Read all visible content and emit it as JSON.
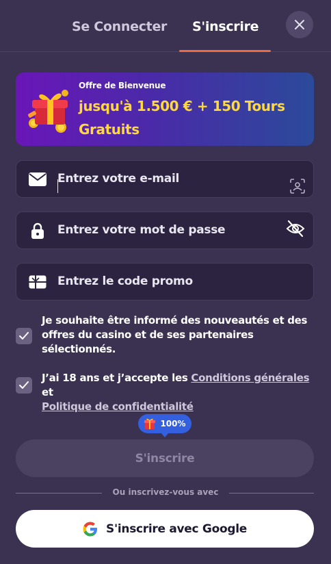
{
  "tabs": {
    "login": "Se Connecter",
    "register": "S'inscrire"
  },
  "banner": {
    "subtitle": "Offre de Bienvenue",
    "title": "jusqu'à 1.500 € + 150 Tours Gratuits"
  },
  "fields": {
    "email": {
      "placeholder": "Entrez votre e-mail",
      "icon": "mail-icon",
      "right_icon": "face-scan-icon"
    },
    "password": {
      "placeholder": "Entrez votre mot de passe",
      "icon": "lock-icon",
      "right_icon": "eye-off-icon"
    },
    "promo": {
      "placeholder": "Entrez le code promo",
      "icon": "gift-card-icon"
    }
  },
  "consents": {
    "news": {
      "checked": true,
      "text": "Je souhaite être informé des nouveautés et des offres du casino et de ses partenaires sélectionnés."
    },
    "age": {
      "checked": true,
      "prefix": "J’ai 18 ans et j’accepte les ",
      "terms_link": "Conditions générales",
      "middle": " et",
      "privacy_link": "Politique de confidentialité"
    }
  },
  "progress": {
    "percent_label": "100%",
    "value": 1.0
  },
  "submit": {
    "label": "S'inscrire"
  },
  "divider": {
    "label": "Ou inscrivez-vous avec"
  },
  "google": {
    "label": "S'inscrire avec Google"
  },
  "colors": {
    "background": "#3b3150",
    "accent": "#ef6a3e",
    "banner_text": "#ffd93b",
    "badge": "#3460e0"
  }
}
